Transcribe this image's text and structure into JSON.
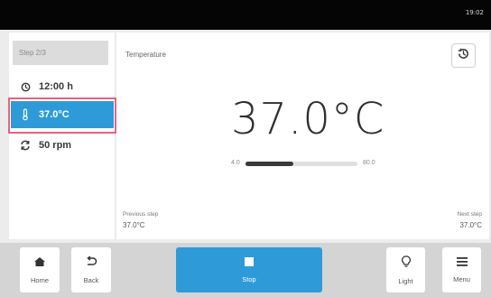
{
  "status_bar": {
    "time": "19:02"
  },
  "sidebar": {
    "step_label": "Step 2/3",
    "items": [
      {
        "label": "12:00 h",
        "icon": "clock-icon"
      },
      {
        "label": "37.0°C",
        "icon": "thermometer-icon"
      },
      {
        "label": "50 rpm",
        "icon": "rotate-icon"
      }
    ]
  },
  "panel": {
    "title": "Temperature",
    "value": "37.0°C",
    "range_min": "4.0",
    "range_max": "80.0",
    "range_fraction": 0.43,
    "previous_step_label": "Previous step",
    "previous_step_value": "37.0°C",
    "next_step_label": "Next step",
    "next_step_value": "37.0°C"
  },
  "toolbar": {
    "home_label": "Home",
    "back_label": "Back",
    "stop_label": "Stop",
    "light_label": "Light",
    "menu_label": "Menu"
  },
  "colors": {
    "accent": "#2e9bd8",
    "highlight": "#ea6183"
  }
}
